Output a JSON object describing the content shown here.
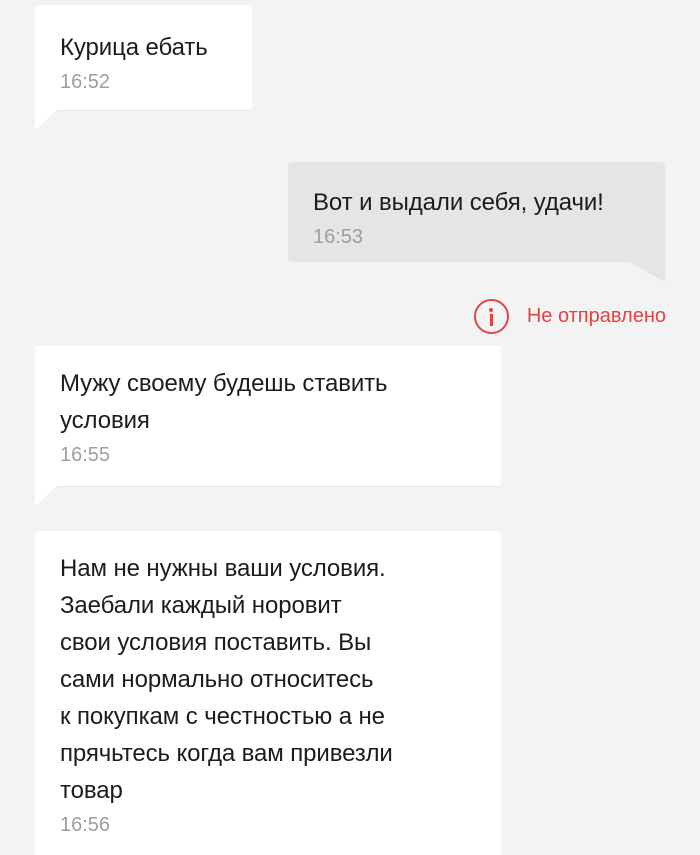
{
  "messages": [
    {
      "direction": "incoming",
      "text": "Курица ебать",
      "time": "16:52"
    },
    {
      "direction": "outgoing",
      "text": "Вот и выдали себя, удачи!",
      "time": "16:53",
      "status": "Не отправлено"
    },
    {
      "direction": "incoming",
      "text": "Мужу своему будешь ставить\nусловия",
      "time": "16:55"
    },
    {
      "direction": "incoming",
      "text": "Нам не нужны ваши условия.\nЗаебали каждый норовит\nсвои условия поставить. Вы\nсами нормально относитесь\nк покупкам с честностью а не\nпрячьтесь когда вам привезли\nтовар",
      "time": "16:56"
    }
  ],
  "icons": {
    "status_error": "info-circle-icon"
  },
  "colors": {
    "background": "#f3f3f3",
    "incoming_bubble": "#ffffff",
    "outgoing_bubble": "#e5e5e5",
    "error": "#e04545",
    "time": "#9e9e9e"
  }
}
